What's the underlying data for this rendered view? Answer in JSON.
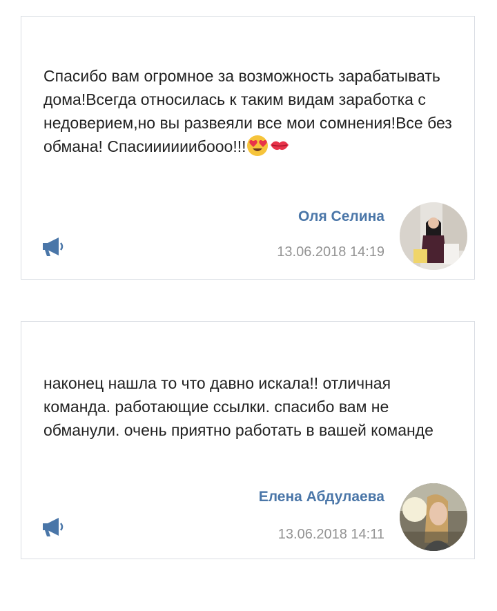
{
  "reviews": [
    {
      "text": "Спасибо вам огромное за возможность зарабатывать дома!Всегда относилась к таким видам заработка с недоверием,но вы развеяли все мои сомнения!Все без обмана! Спасиииииибооо!!!",
      "emojis": [
        "heart-eyes-emoji",
        "kiss-mark-emoji"
      ],
      "author": "Оля Селина",
      "datetime": "13.06.2018 14:19"
    },
    {
      "text": "наконец нашла то что давно искала!! отличная команда. работающие ссылки. спасибо вам не обманули. очень приятно работать в вашей команде",
      "author": "Елена Абдулаева",
      "datetime": "13.06.2018 14:11"
    }
  ],
  "colors": {
    "accent": "#4a76a8",
    "text": "#222222",
    "meta": "#939393",
    "border": "#d9dde3"
  }
}
